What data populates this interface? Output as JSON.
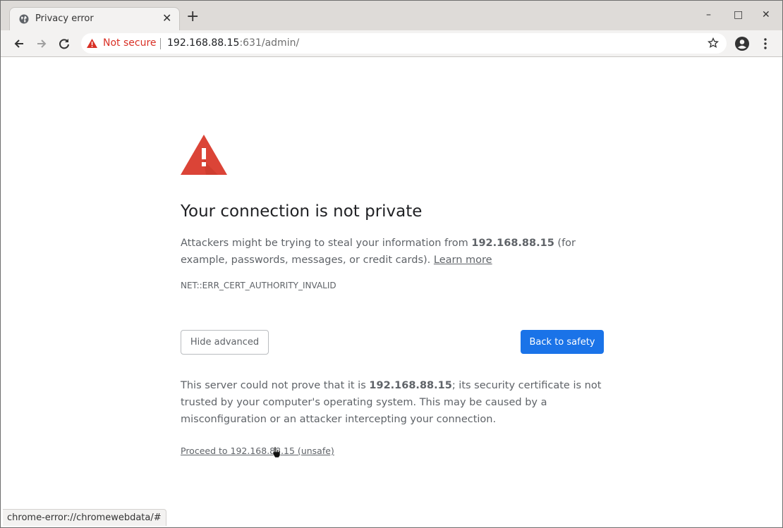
{
  "browser": {
    "tab": {
      "title": "Privacy error",
      "icon": "globe-icon"
    },
    "new_tab_label": "+",
    "window_controls": {
      "minimize": "–",
      "maximize": "□",
      "close": "✕"
    },
    "address_bar": {
      "security_label": "Not secure",
      "url_host": "192.168.88.15",
      "url_rest": ":631/admin/"
    },
    "status_url": "chrome-error://chromewebdata/#"
  },
  "colors": {
    "accent": "#1a73e8",
    "danger": "#d93025",
    "warning_icon": "#db4437"
  },
  "page": {
    "heading": "Your connection is not private",
    "intro_before": "Attackers might be trying to steal your information from ",
    "intro_host": "192.168.88.15",
    "intro_after": " (for example, passwords, messages, or credit cards). ",
    "learn_more": "Learn more",
    "error_code": "NET::ERR_CERT_AUTHORITY_INVALID",
    "hide_advanced": "Hide advanced",
    "back_to_safety": "Back to safety",
    "details_before": "This server could not prove that it is ",
    "details_host": "192.168.88.15",
    "details_after": "; its security certificate is not trusted by your computer's operating system. This may be caused by a misconfiguration or an attacker intercepting your connection.",
    "proceed_link": "Proceed to 192.168.88.15 (unsafe)"
  }
}
